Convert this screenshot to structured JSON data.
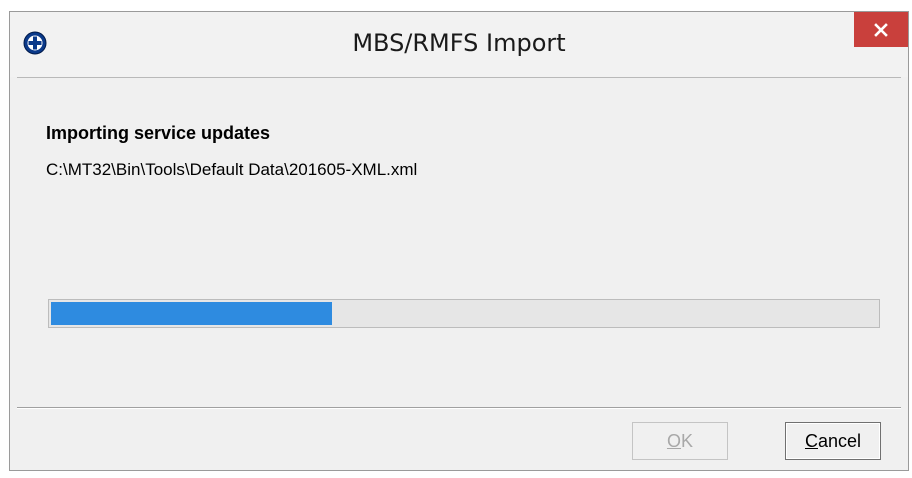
{
  "window": {
    "title": "MBS/RMFS Import",
    "icon": "app-logo-icon",
    "close_icon": "close-icon",
    "close_color": "#c9403c"
  },
  "content": {
    "heading": "Importing service updates",
    "file_path": "C:\\MT32\\Bin\\Tools\\Default Data\\201605-XML.xml"
  },
  "progress": {
    "fraction": 0.34,
    "color": "#2e8be0"
  },
  "buttons": {
    "ok": {
      "mnemonic": "O",
      "rest": "K",
      "enabled": false
    },
    "cancel": {
      "mnemonic": "C",
      "rest": "ancel",
      "enabled": true
    }
  }
}
